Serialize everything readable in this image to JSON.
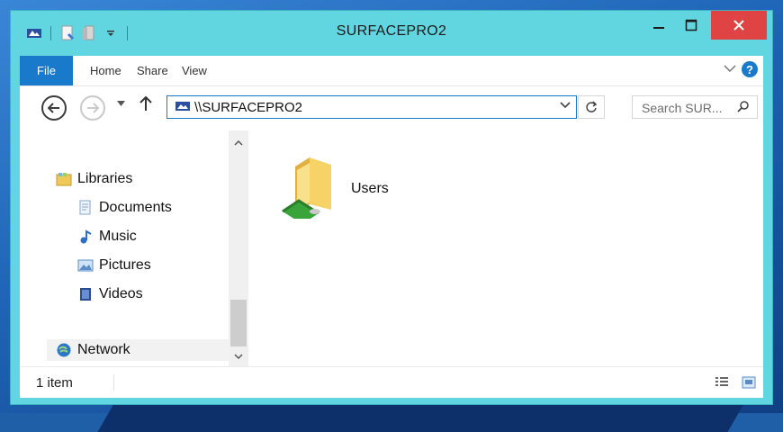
{
  "window": {
    "title": "SURFACEPRO2"
  },
  "ribbon": {
    "tabs": [
      "File",
      "Home",
      "Share",
      "View"
    ],
    "help_label": "?"
  },
  "address": {
    "path": "\\\\SURFACEPRO2",
    "search_placeholder": "Search SUR... "
  },
  "navigation": {
    "libraries": "Libraries",
    "documents": "Documents",
    "music": "Music",
    "pictures": "Pictures",
    "videos": "Videos",
    "network": "Network"
  },
  "files": [
    {
      "name": "Users",
      "icon": "shared-folder-icon"
    }
  ],
  "status": {
    "item_count": "1 item"
  },
  "colors": {
    "titlebar": "#62d6e0",
    "file_tab": "#1979ca",
    "close": "#e04343",
    "accent_border": "#1979ca"
  }
}
